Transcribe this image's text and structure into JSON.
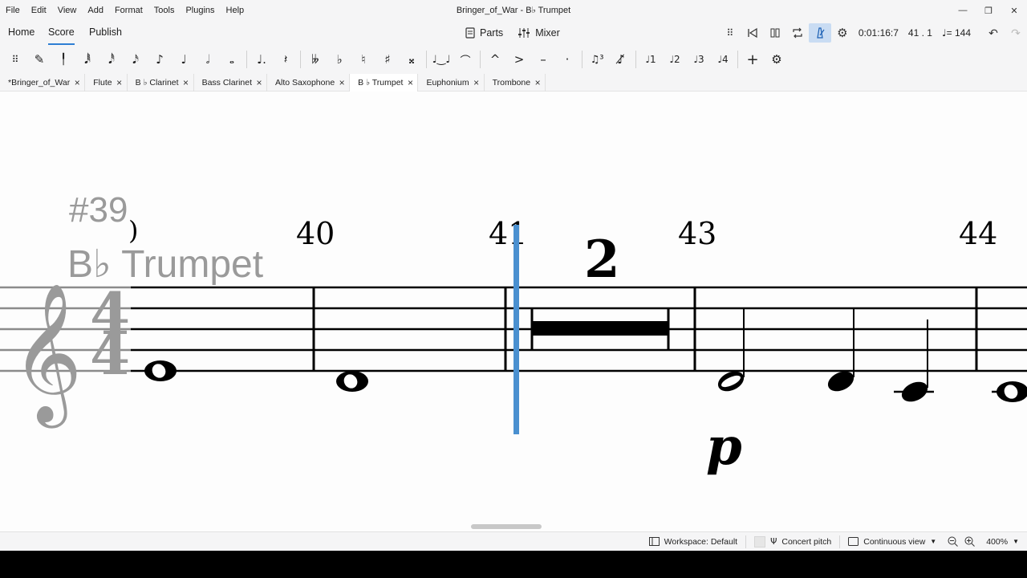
{
  "window": {
    "title": "Bringer_of_War - B♭ Trumpet",
    "controls": [
      "—",
      "❐",
      "✕"
    ]
  },
  "menu": [
    "File",
    "Edit",
    "View",
    "Add",
    "Format",
    "Tools",
    "Plugins",
    "Help"
  ],
  "nav": {
    "tabs": [
      "Home",
      "Score",
      "Publish"
    ],
    "active": "Score",
    "parts_label": "Parts",
    "mixer_label": "Mixer",
    "time": "0:01:16:7",
    "position": "41 . 1",
    "tempo": "= 144"
  },
  "score_tabs": [
    {
      "label": "*Bringer_of_War"
    },
    {
      "label": "Flute"
    },
    {
      "label": "B ♭ Clarinet"
    },
    {
      "label": "Bass Clarinet"
    },
    {
      "label": "Alto Saxophone"
    },
    {
      "label": "B ♭ Trumpet"
    },
    {
      "label": "Euphonium"
    },
    {
      "label": "Trombone"
    }
  ],
  "score": {
    "rehearsal_mark": "#39",
    "instrument": "B♭ Trumpet",
    "time_signature_top": "4",
    "time_signature_bottom": "4",
    "measure_numbers": [
      "40",
      "41",
      "43",
      "44"
    ],
    "multirest_count": "2",
    "dynamic": "p",
    "colors": {
      "cursor": "#4a90d0",
      "ink": "#000000",
      "faded": "#9a9a9a"
    }
  },
  "status": {
    "workspace": "Workspace: Default",
    "concert_pitch": "Concert pitch",
    "view_mode": "Continuous view",
    "zoom": "400%"
  }
}
